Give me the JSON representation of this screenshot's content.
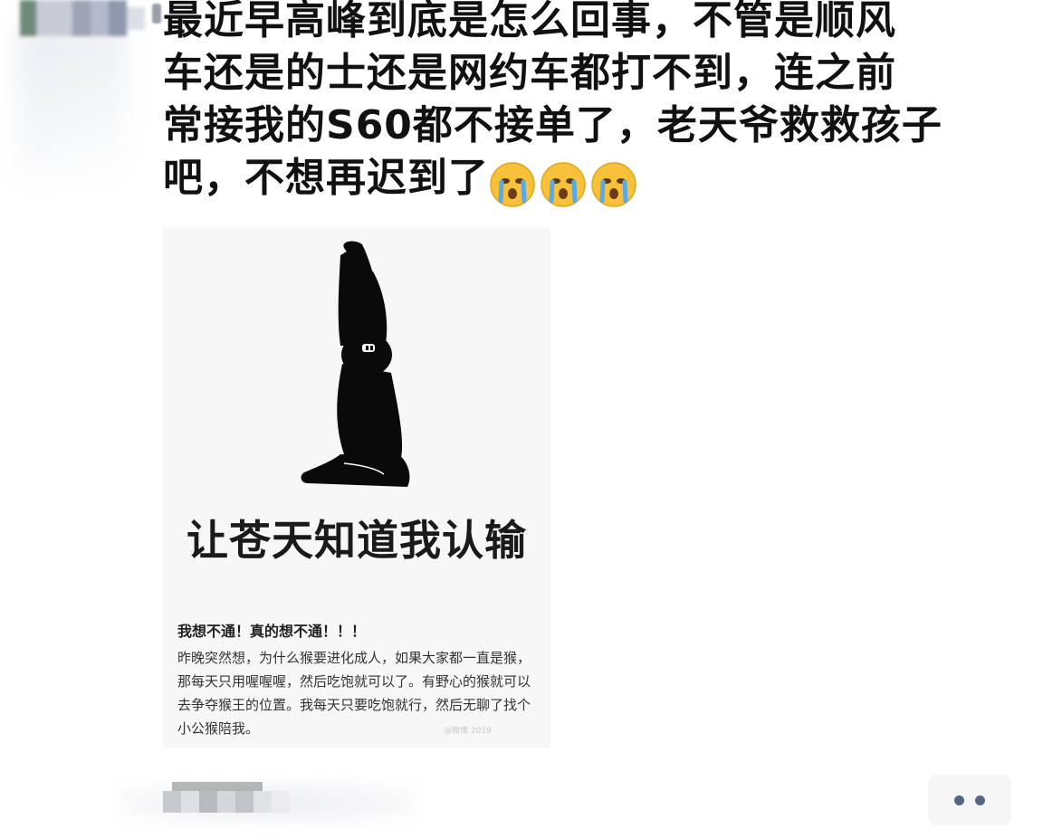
{
  "post": {
    "lines": [
      "最近早高峰到底是怎么回事，不管是顺风",
      "车还是的士还是网约车都打不到，连之前",
      "常接我的S60都不接单了，老天爷救救孩子",
      "吧，不想再迟到了"
    ],
    "emojis": [
      "crying-emoji",
      "crying-emoji",
      "crying-emoji"
    ]
  },
  "meme": {
    "caption": "让苍天知道我认输",
    "title": "我想不通！真的想不通！！！",
    "body": "昨晚突然想，为什么猴要进化成人，如果大家都一直是猴，那每天只用喔喔喔，然后吃饱就可以了。有野心的猴就可以去争夺猴王的位置。我每天只要吃饱就行，然后无聊了找个小公猴陪我。",
    "watermark": "@微博 2019"
  },
  "colors": {
    "text": "#111111",
    "more_dots": "#546682",
    "more_bg": "#f6f6f7"
  },
  "icons": {
    "more": "more-dots-icon"
  }
}
